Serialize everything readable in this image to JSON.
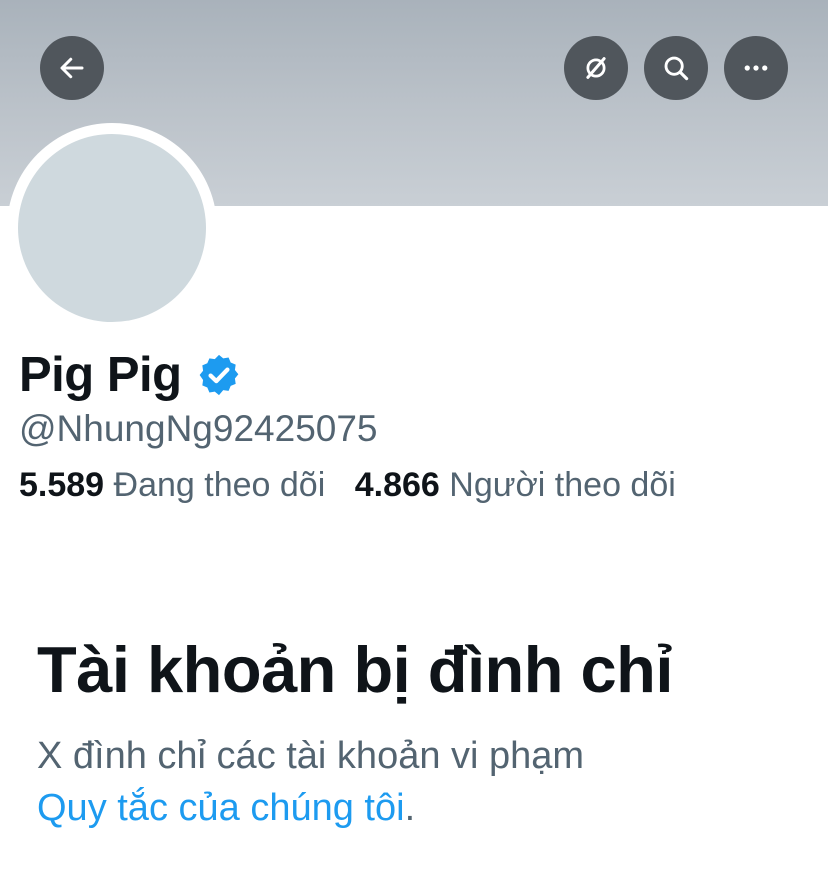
{
  "header": {
    "back_icon": "arrow-left-icon",
    "hide_icon": "eye-slash-icon",
    "search_icon": "search-icon",
    "more_icon": "more-horizontal-icon",
    "banner_color": "#bcc3ca",
    "button_color": "#50565c"
  },
  "profile": {
    "display_name": "Pig Pig",
    "verified": true,
    "verified_color": "#1d9bf0",
    "handle": "@NhungNg92425075",
    "avatar_color": "#cfd9de",
    "stats": {
      "following_count": "5.589",
      "following_label": "Đang theo dõi",
      "followers_count": "4.866",
      "followers_label": "Người theo dõi"
    }
  },
  "suspended": {
    "title": "Tài khoản bị đình chỉ",
    "message": "X đình chỉ các tài khoản vi phạm",
    "link_text": "Quy tắc của chúng tôi",
    "punctuation": ".",
    "link_color": "#1d9bf0"
  }
}
